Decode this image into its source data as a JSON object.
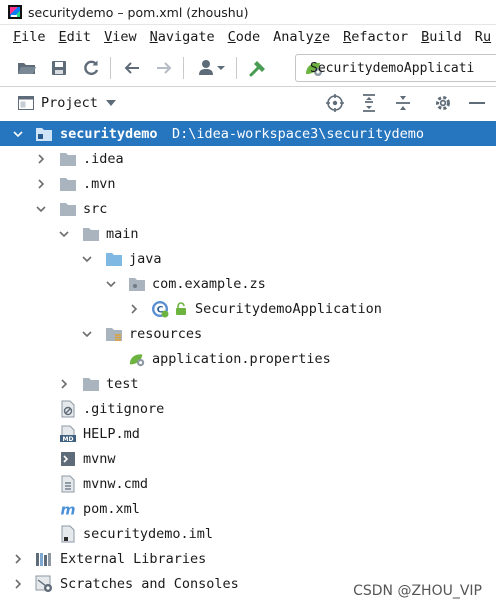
{
  "window": {
    "title": "securitydemo – pom.xml (zhoushu)"
  },
  "menubar": {
    "items": [
      {
        "label": "File",
        "mnemonic": "F"
      },
      {
        "label": "Edit",
        "mnemonic": "E"
      },
      {
        "label": "View",
        "mnemonic": "V"
      },
      {
        "label": "Navigate",
        "mnemonic": "N"
      },
      {
        "label": "Code",
        "mnemonic": "C"
      },
      {
        "label": "Analyze",
        "mnemonic": "z"
      },
      {
        "label": "Refactor",
        "mnemonic": "R"
      },
      {
        "label": "Build",
        "mnemonic": "B"
      },
      {
        "label": "Ru",
        "mnemonic": "u"
      }
    ]
  },
  "toolbar": {
    "run_config_label": "SecuritydemoApplicati"
  },
  "project_panel": {
    "title": "Project"
  },
  "tree": {
    "root_name": "securitydemo",
    "root_path": "D:\\idea-workspace3\\securitydemo",
    "items": [
      {
        "label": ".idea"
      },
      {
        "label": ".mvn"
      },
      {
        "label": "src"
      },
      {
        "label": "main"
      },
      {
        "label": "java"
      },
      {
        "label": "com.example.zs"
      },
      {
        "label": "SecuritydemoApplication"
      },
      {
        "label": "resources"
      },
      {
        "label": "application.properties"
      },
      {
        "label": "test"
      },
      {
        "label": ".gitignore"
      },
      {
        "label": "HELP.md"
      },
      {
        "label": "mvnw"
      },
      {
        "label": "mvnw.cmd"
      },
      {
        "label": "pom.xml"
      },
      {
        "label": "securitydemo.iml"
      },
      {
        "label": "External Libraries"
      },
      {
        "label": "Scratches and Consoles"
      }
    ]
  },
  "watermark": "CSDN @ZHOU_VIP",
  "colors": {
    "selection": "#2675bf",
    "folder": "#a9b4bf",
    "source_folder": "#7fb9e3",
    "spring_green": "#6db33f",
    "build_green": "#499c54"
  }
}
